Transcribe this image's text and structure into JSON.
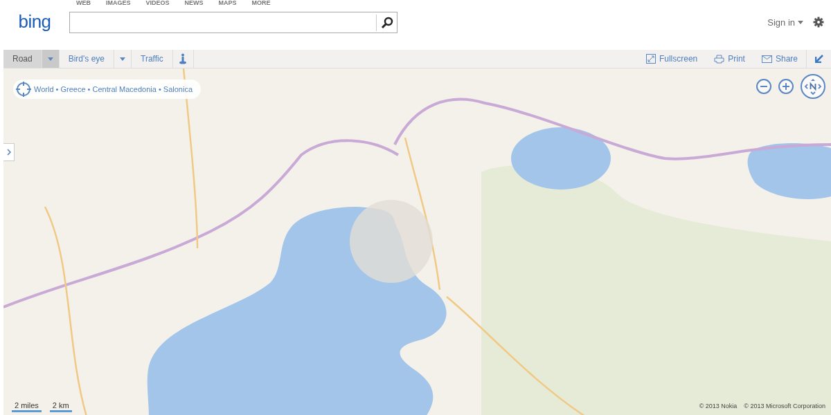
{
  "nav_links": [
    "WEB",
    "IMAGES",
    "VIDEOS",
    "NEWS",
    "MAPS",
    "MORE"
  ],
  "logo": "bing",
  "sign_in": "Sign in",
  "map_types": [
    {
      "label": "Road",
      "selected": true,
      "dropdown": true
    },
    {
      "label": "Bird's eye",
      "selected": false,
      "dropdown": true
    },
    {
      "label": "Traffic",
      "selected": false,
      "dropdown": false
    }
  ],
  "toolbar_actions": [
    {
      "kind": "fullscreen",
      "label": "Fullscreen"
    },
    {
      "kind": "print",
      "label": "Print"
    },
    {
      "kind": "share",
      "label": "Share"
    }
  ],
  "breadcrumb": "World • Greece • Central Macedonia • Salonica",
  "scale": [
    "2 miles",
    "2 km"
  ],
  "copyright": [
    "© 2013 Nokia",
    "© 2013 Microsoft Corporation"
  ]
}
